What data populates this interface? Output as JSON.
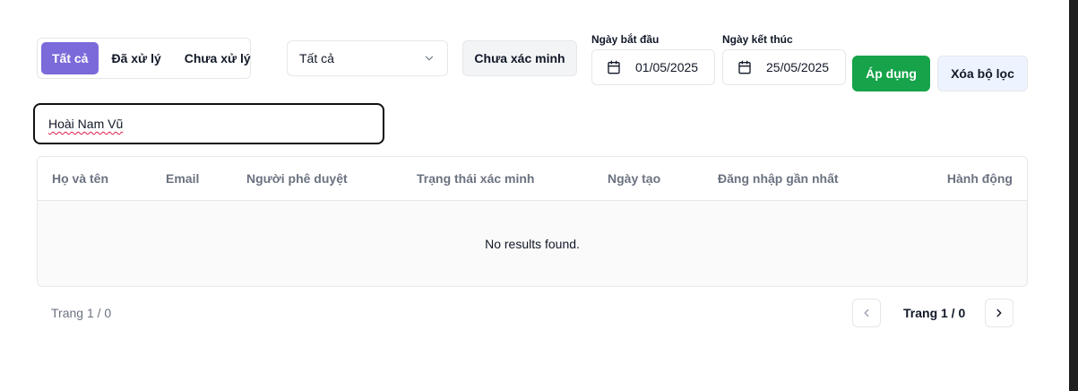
{
  "filters": {
    "status_tabs": [
      {
        "label": "Tất cả",
        "active": true
      },
      {
        "label": "Đã xử lý",
        "active": false
      },
      {
        "label": "Chưa xử lý",
        "active": false
      }
    ],
    "select_value": "Tất cả",
    "unverified_button": "Chưa xác minh",
    "start_date": {
      "label": "Ngày bắt đầu",
      "value": "01/05/2025"
    },
    "end_date": {
      "label": "Ngày kết thúc",
      "value": "25/05/2025"
    },
    "apply_button": "Áp dụng",
    "clear_button": "Xóa bộ lọc"
  },
  "search": {
    "value": "Hoài Nam Vũ"
  },
  "table": {
    "columns": [
      "Họ và tên",
      "Email",
      "Người phê duyệt",
      "Trạng thái xác minh",
      "Ngày tạo",
      "Đăng nhập gần nhất",
      "Hành động"
    ],
    "empty_message": "No results found."
  },
  "pagination": {
    "summary": "Trang 1 / 0",
    "current": "Trang 1 / 0"
  },
  "colors": {
    "active_tab": "#7b6ad9",
    "apply": "#16a34a",
    "clear": "#eef4ff"
  },
  "icons": [
    "chevron-down-icon",
    "calendar-icon",
    "chevron-left-icon",
    "chevron-right-icon"
  ]
}
